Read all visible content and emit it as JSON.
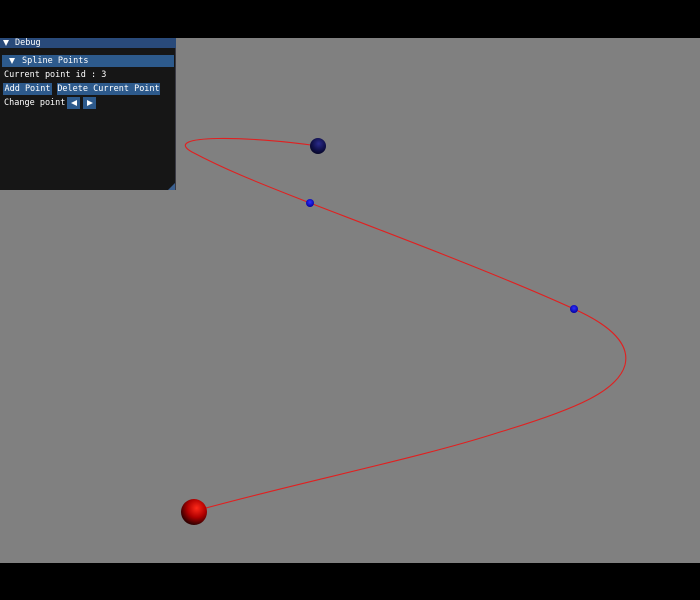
{
  "debug_window": {
    "title": "Debug",
    "section_label": "Spline Points",
    "current_point_label": "Current point id",
    "current_point_separator": ":",
    "current_point_value": "3",
    "add_point_label": "Add Point",
    "delete_point_label": "Delete Current Point",
    "change_point_label": "Change point"
  },
  "colors": {
    "background": "#808080",
    "window_bg": "#0f0f0f",
    "title_bar": "#294a7a",
    "button": "#2d5a8c",
    "spline": "#e02020",
    "start_sphere": "#c00000",
    "end_sphere": "#101050",
    "control_point": "#0000cc"
  },
  "scene": {
    "spline_name": "spline-curve",
    "start_sphere": "red-sphere",
    "end_sphere": "dark-blue-sphere",
    "control_points": [
      "control-point-1",
      "control-point-2"
    ]
  }
}
